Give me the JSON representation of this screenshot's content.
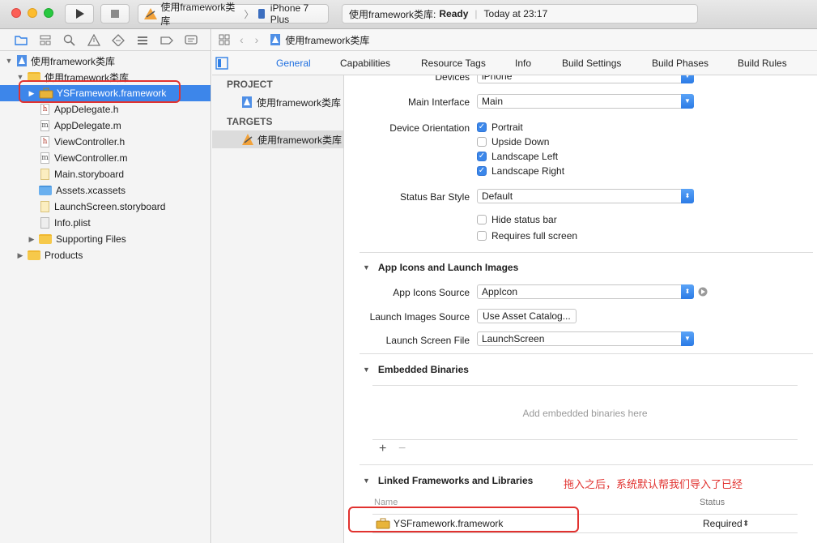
{
  "toolbar": {
    "scheme": "使用framework类库",
    "device": "iPhone 7 Plus",
    "status_project": "使用framework类库:",
    "status_state": "Ready",
    "status_time": "Today at 23:17"
  },
  "navigator": {
    "project": "使用framework类库",
    "group": "使用framework类库",
    "items": [
      {
        "label": "YSFramework.framework"
      },
      {
        "label": "AppDelegate.h",
        "kind": "h"
      },
      {
        "label": "AppDelegate.m",
        "kind": "m"
      },
      {
        "label": "ViewController.h",
        "kind": "h"
      },
      {
        "label": "ViewController.m",
        "kind": "m"
      },
      {
        "label": "Main.storyboard"
      },
      {
        "label": "Assets.xcassets"
      },
      {
        "label": "LaunchScreen.storyboard"
      },
      {
        "label": "Info.plist"
      },
      {
        "label": "Supporting Files"
      },
      {
        "label": "Products"
      }
    ]
  },
  "jumpbar": {
    "crumb": "使用framework类库"
  },
  "tabs": [
    "General",
    "Capabilities",
    "Resource Tags",
    "Info",
    "Build Settings",
    "Build Phases",
    "Build Rules"
  ],
  "targets": {
    "project_header": "PROJECT",
    "project_item": "使用framework类库",
    "targets_header": "TARGETS",
    "target_item": "使用framework类库"
  },
  "deployment": {
    "devices_label": "Devices",
    "devices_value": "iPhone",
    "main_interface_label": "Main Interface",
    "main_interface_value": "Main",
    "orientation_label": "Device Orientation",
    "orientations": [
      {
        "label": "Portrait",
        "checked": true
      },
      {
        "label": "Upside Down",
        "checked": false
      },
      {
        "label": "Landscape Left",
        "checked": true
      },
      {
        "label": "Landscape Right",
        "checked": true
      }
    ],
    "status_bar_label": "Status Bar Style",
    "status_bar_value": "Default",
    "hide_status_bar": "Hide status bar",
    "requires_full_screen": "Requires full screen"
  },
  "app_icons": {
    "title": "App Icons and Launch Images",
    "icons_source_label": "App Icons Source",
    "icons_source_value": "AppIcon",
    "launch_images_label": "Launch Images Source",
    "launch_images_button": "Use Asset Catalog...",
    "launch_screen_label": "Launch Screen File",
    "launch_screen_value": "LaunchScreen"
  },
  "embedded": {
    "title": "Embedded Binaries",
    "placeholder": "Add embedded binaries here",
    "add": "+",
    "remove": "−"
  },
  "linked": {
    "title": "Linked Frameworks and Libraries",
    "annotation": "拖入之后，系统默认帮我们导入了已经",
    "col_name": "Name",
    "col_status": "Status",
    "row_name": "YSFramework.framework",
    "row_status": "Required"
  },
  "colors": {
    "accent": "#3d86ea",
    "annotation": "#e1322f"
  }
}
